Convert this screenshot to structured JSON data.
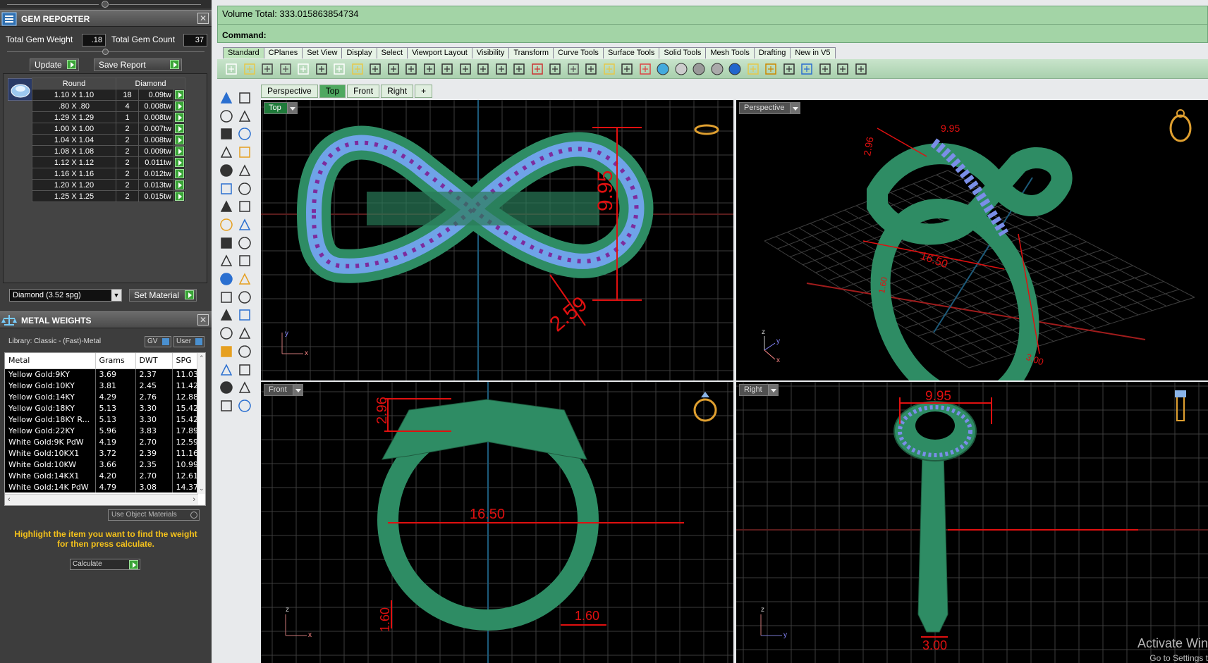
{
  "gem_reporter": {
    "title": "GEM REPORTER",
    "total_gem_weight_label": "Total Gem Weight",
    "total_gem_weight": ".18",
    "total_gem_count_label": "Total Gem Count",
    "total_gem_count": "37",
    "update_label": "Update",
    "save_report_label": "Save Report",
    "columns": [
      "Round",
      "Diamond"
    ],
    "rows": [
      [
        "1.10 X 1.10",
        "18",
        "0.09tw"
      ],
      [
        ".80 X .80",
        "4",
        "0.008tw"
      ],
      [
        "1.29 X 1.29",
        "1",
        "0.008tw"
      ],
      [
        "1.00 X 1.00",
        "2",
        "0.007tw"
      ],
      [
        "1.04 X 1.04",
        "2",
        "0.008tw"
      ],
      [
        "1.08 X 1.08",
        "2",
        "0.009tw"
      ],
      [
        "1.12 X 1.12",
        "2",
        "0.011tw"
      ],
      [
        "1.16 X 1.16",
        "2",
        "0.012tw"
      ],
      [
        "1.20 X 1.20",
        "2",
        "0.013tw"
      ],
      [
        "1.25 X 1.25",
        "2",
        "0.015tw"
      ]
    ],
    "material_select": "Diamond    (3.52 spg)",
    "set_material_label": "Set Material"
  },
  "metal_weights": {
    "title": "METAL WEIGHTS",
    "library": "Library: Classic - (Fast)-Metal",
    "gv_label": "GV",
    "user_label": "User",
    "columns": [
      "Metal",
      "Grams",
      "DWT",
      "SPG"
    ],
    "rows": [
      [
        "Yellow Gold:9KY",
        "3.69",
        "2.37",
        "11.03"
      ],
      [
        "Yellow Gold:10KY",
        "3.81",
        "2.45",
        "11.42"
      ],
      [
        "Yellow Gold:14KY",
        "4.29",
        "2.76",
        "12.88"
      ],
      [
        "Yellow Gold:18KY",
        "5.13",
        "3.30",
        "15.42"
      ],
      [
        "Yellow Gold:18KY R...",
        "5.13",
        "3.30",
        "15.42"
      ],
      [
        "Yellow Gold:22KY",
        "5.96",
        "3.83",
        "17.89"
      ],
      [
        "White Gold:9K PdW",
        "4.19",
        "2.70",
        "12.59"
      ],
      [
        "White Gold:10KX1",
        "3.72",
        "2.39",
        "11.16"
      ],
      [
        "White Gold:10KW",
        "3.66",
        "2.35",
        "10.99"
      ],
      [
        "White Gold:14KX1",
        "4.20",
        "2.70",
        "12.61"
      ],
      [
        "White Gold:14K PdW",
        "4.79",
        "3.08",
        "14.37"
      ]
    ],
    "use_object_materials": "Use Object Materials",
    "hint": "Highlight the item you want to find the weight for then press calculate.",
    "calculate_label": "Calculate"
  },
  "command": {
    "volume_line": "Volume Total: 333.015863854734",
    "prompt": "Command:"
  },
  "ribbon_tabs": [
    "Standard",
    "CPlanes",
    "Set View",
    "Display",
    "Select",
    "Viewport Layout",
    "Visibility",
    "Transform",
    "Curve Tools",
    "Surface Tools",
    "Solid Tools",
    "Mesh Tools",
    "Drafting",
    "New in V5"
  ],
  "viewport_tabs": [
    "Perspective",
    "Top",
    "Front",
    "Right",
    "+"
  ],
  "viewports": {
    "top": {
      "name": "Top",
      "dims": [
        "9.95",
        "2.59"
      ]
    },
    "perspective": {
      "name": "Perspective",
      "dims": [
        "2.96",
        "9.95",
        "16.50",
        "1.60",
        "3.00"
      ]
    },
    "front": {
      "name": "Front",
      "dims": [
        "2.96",
        "16.50",
        "1.60",
        "1.60"
      ]
    },
    "right": {
      "name": "Right",
      "dims": [
        "9.95",
        "3.00"
      ]
    }
  },
  "watermark": {
    "line1": "Activate Win",
    "line2": "Go to Settings t"
  },
  "colors": {
    "ring": "#2e8c64",
    "dimension": "#e01010",
    "cmd_bg": "#a3d4a6"
  }
}
